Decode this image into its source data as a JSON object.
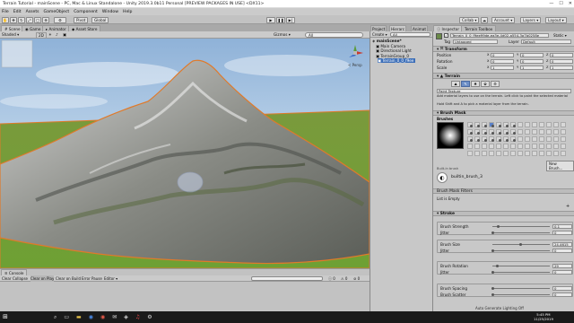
{
  "window": {
    "title": "Terrain Tutorial - mainScene - PC, Mac & Linux Standalone - Unity 2019.3.0b11 Personal [PREVIEW PACKAGES IN USE] <DX11>",
    "controls": [
      "—",
      "☐",
      "✕"
    ]
  },
  "menu": [
    "File",
    "Edit",
    "Assets",
    "GameObject",
    "Component",
    "Window",
    "Help"
  ],
  "toolbar": {
    "pivot": "Pivot",
    "global": "Global",
    "collab": "Collab ▾",
    "account": "Account",
    "layers": "Layers",
    "layout": "Layout"
  },
  "scene": {
    "tabs": [
      "Scene",
      "Game",
      "Animator",
      "Asset Store"
    ],
    "shading": "Shaded",
    "mode": "2D",
    "gizmos": "Gizmos",
    "search": "All",
    "persp": "< Persp"
  },
  "console": {
    "tab": "Console",
    "buttons": [
      "Clear",
      "Collapse",
      "Clear on Play",
      "Clear on Build",
      "Error Pause",
      "Editor ▾"
    ],
    "counts": [
      "0",
      "0",
      "0"
    ]
  },
  "hierarchy": {
    "tabs": [
      "Project",
      "Hierarc",
      "Animat"
    ],
    "create": "Create",
    "search": "All",
    "items": [
      "mainScene*",
      "Main Camera",
      "Directional Light",
      "TerrainGroup_0",
      "Terrain_0_0_f9ee"
    ]
  },
  "inspector": {
    "tabs": [
      "Inspector",
      "Terrain Toolbox"
    ],
    "object_name": "Terrain_0_0_f9ee99de-ea3e-4d02-a554-3a7b0258e",
    "static": "Static ▾",
    "tag_label": "Tag",
    "tag_value": "Untagged",
    "layer_label": "Layer",
    "layer_value": "Default",
    "transform": {
      "title": "Transform",
      "rows": [
        {
          "label": "Position",
          "x": "0",
          "y": "0",
          "z": "0"
        },
        {
          "label": "Rotation",
          "x": "0",
          "y": "0",
          "z": "0"
        },
        {
          "label": "Scale",
          "x": "1",
          "y": "1",
          "z": "1"
        }
      ]
    },
    "terrain": {
      "title": "Terrain",
      "mode": "Paint Texture",
      "help1": "Add material layers to use on the terrain. Left click to paint the selected material",
      "help2": "Hold Shift and A to pick a material layer from the terrain.",
      "brush_mask": "Brush Mask",
      "brushes_label": "Brushes",
      "new_brush": "New Brush...",
      "built_in": "Built-in brush",
      "brush_name": "builtin_brush_3",
      "mask_filters": "Brush Mask Filters",
      "list_empty": "List is Empty",
      "stroke": "Stroke",
      "sliders": [
        {
          "label": "Brush Strength",
          "value": "0.1",
          "fraction": 0.1
        },
        {
          "label": "Jitter",
          "value": "0",
          "fraction": 0
        },
        {
          "label": "Brush Size",
          "value": "24.4615",
          "fraction": 0.49
        },
        {
          "label": "Jitter",
          "value": "0",
          "fraction": 0
        },
        {
          "label": "Brush Rotation",
          "value": "29",
          "fraction": 0.08
        },
        {
          "label": "Jitter",
          "value": "0",
          "fraction": 0
        },
        {
          "label": "Brush Spacing",
          "value": "0",
          "fraction": 0
        },
        {
          "label": "Brush Scatter",
          "value": "0",
          "fraction": 0
        }
      ]
    }
  },
  "status": {
    "right": "Auto Generate Lighting Off"
  },
  "taskbar": {
    "time": "5:45 PM",
    "date": "11/25/2019"
  }
}
